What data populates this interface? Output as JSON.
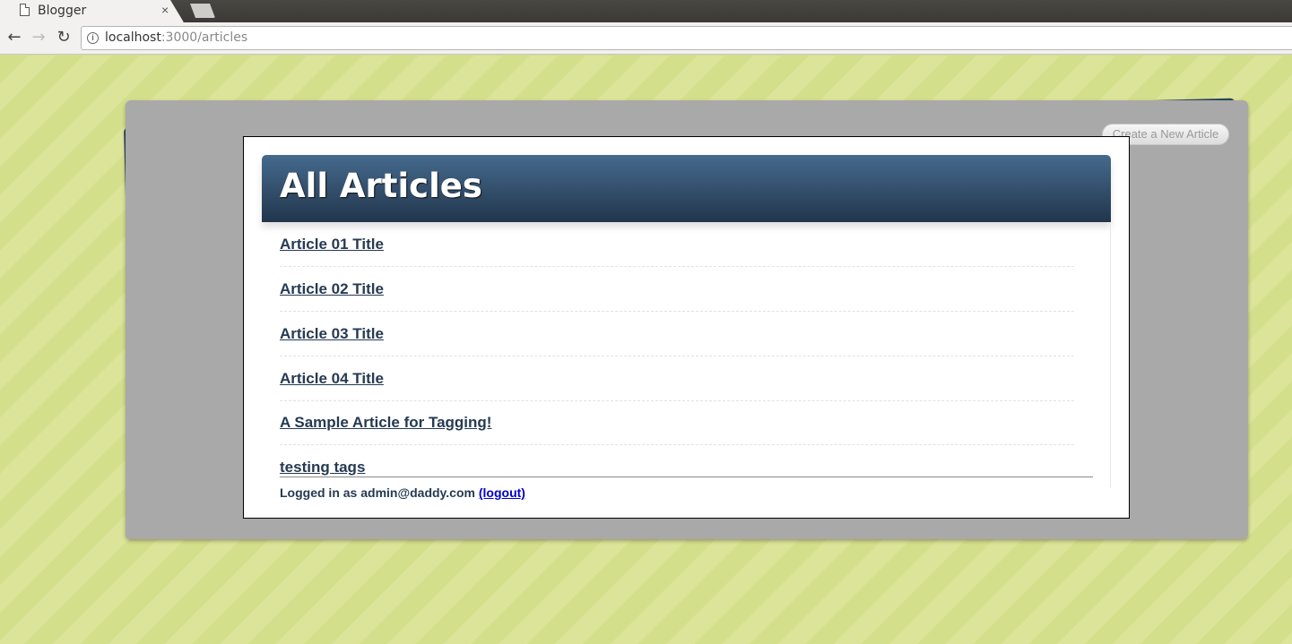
{
  "browser": {
    "tab_title": "Blogger",
    "tab_close": "×",
    "url_host": "localhost",
    "url_path": ":3000/articles",
    "back_icon": "←",
    "forward_icon": "→",
    "reload_icon": "↻",
    "info_icon": "i"
  },
  "page": {
    "create_button_label": "Create a New Article",
    "heading": "All Articles",
    "articles": [
      {
        "title": "Article 01 Title"
      },
      {
        "title": "Article 02 Title"
      },
      {
        "title": "Article 03 Title"
      },
      {
        "title": "Article 04 Title"
      },
      {
        "title": "A Sample Article for Tagging!"
      },
      {
        "title": "testing tags"
      }
    ],
    "footer": {
      "logged_in_text": "Logged in as admin@daddy.com",
      "logout_label": "(logout)"
    }
  },
  "colors": {
    "background": "#d4df8c",
    "header_top": "#456a8e",
    "header_bottom": "#22364c",
    "link": "#253a52",
    "panel": "#a9a9a9"
  }
}
